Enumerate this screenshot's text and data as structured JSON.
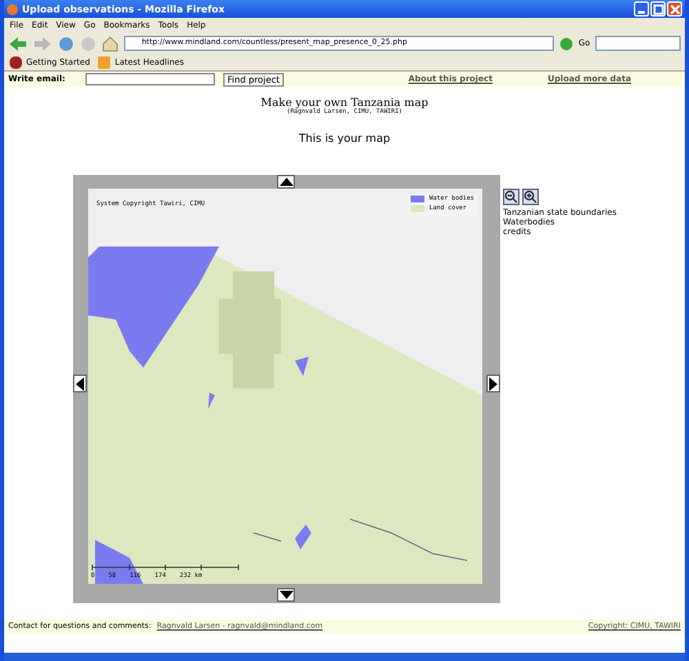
{
  "window": {
    "title": "Upload observations - Mozilla Firefox"
  },
  "menu": [
    "File",
    "Edit",
    "View",
    "Go",
    "Bookmarks",
    "Tools",
    "Help"
  ],
  "address": {
    "value": "http://www.mindland.com/countless/present_map_presence_0_25.php"
  },
  "go_label": "Go",
  "bookmarks": [
    "Getting Started",
    "Latest Headlines"
  ],
  "top_bar": {
    "email_label": "Write email:",
    "button": "Find project",
    "links": [
      "About this project",
      "Upload more data"
    ]
  },
  "heading": {
    "title": "Make your own Tanzania map",
    "subtitle": "(Ragnvald Larsen, CIMU, TAWIRI)",
    "caption": "This is your map"
  },
  "map": {
    "copyright": "System Copyright Tawiri, CIMU",
    "legend": [
      {
        "label": "Water bodies",
        "color": "#7b7bf0"
      },
      {
        "label": "Land cover",
        "color": "#dde8c0"
      }
    ],
    "scale": [
      "0",
      "58",
      "116",
      "174",
      "232 km"
    ]
  },
  "layers": [
    "Tanzanian state boundaries",
    "Waterbodies",
    "credits"
  ],
  "footer": {
    "text": "Contact for questions and comments:",
    "link": "Ragnvald Larsen - ragnvald@mindland.com",
    "copyright": "Copyright: CIMU, TAWIRI"
  }
}
